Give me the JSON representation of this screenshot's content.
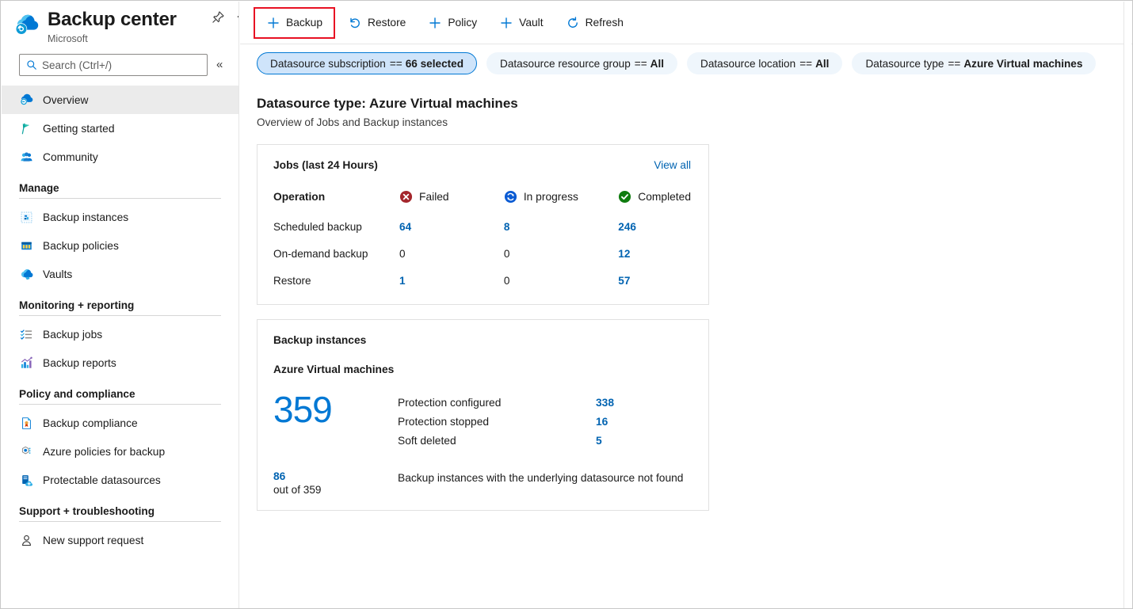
{
  "colors": {
    "accent": "#0078d4",
    "link": "#0063b1",
    "highlight_border": "#e81123",
    "failed": "#a4262c",
    "in_progress": "#0078d4",
    "completed": "#107c10",
    "pill_bg": "#eff6fc",
    "pill_selected_bg": "#cfe4fa"
  },
  "titlebar": {
    "title": "Backup center",
    "subtitle": "Microsoft",
    "logo_icon": "backup-center-cloud-icon",
    "pin_icon": "pin-icon",
    "more_icon": "ellipsis-icon",
    "more_label": "..."
  },
  "search": {
    "placeholder": "Search (Ctrl+/)",
    "value": "",
    "icon": "search-icon",
    "collapse_icon": "chevron-double-left-icon",
    "collapse_label": "«"
  },
  "sidebar": {
    "top_items": [
      {
        "label": "Overview",
        "icon": "backup-cloud-icon",
        "active": true
      },
      {
        "label": "Getting started",
        "icon": "flag-icon",
        "active": false
      },
      {
        "label": "Community",
        "icon": "community-icon",
        "active": false
      }
    ],
    "groups": [
      {
        "title": "Manage",
        "items": [
          {
            "label": "Backup instances",
            "icon": "backup-instances-icon"
          },
          {
            "label": "Backup policies",
            "icon": "backup-policies-icon"
          },
          {
            "label": "Vaults",
            "icon": "vault-cloud-icon"
          }
        ]
      },
      {
        "title": "Monitoring + reporting",
        "items": [
          {
            "label": "Backup jobs",
            "icon": "checklist-icon"
          },
          {
            "label": "Backup reports",
            "icon": "bar-chart-icon"
          }
        ]
      },
      {
        "title": "Policy and compliance",
        "items": [
          {
            "label": "Backup compliance",
            "icon": "compliance-document-icon"
          },
          {
            "label": "Azure policies for backup",
            "icon": "policy-hexagon-icon"
          },
          {
            "label": "Protectable datasources",
            "icon": "protectable-datasource-icon"
          }
        ]
      },
      {
        "title": "Support + troubleshooting",
        "items": [
          {
            "label": "New support request",
            "icon": "support-person-icon"
          }
        ]
      }
    ]
  },
  "toolbar": {
    "commands": [
      {
        "label": "Backup",
        "icon": "plus-icon",
        "highlighted": true
      },
      {
        "label": "Restore",
        "icon": "restore-icon",
        "highlighted": false
      },
      {
        "label": "Policy",
        "icon": "plus-icon",
        "highlighted": false
      },
      {
        "label": "Vault",
        "icon": "plus-icon",
        "highlighted": false
      },
      {
        "label": "Refresh",
        "icon": "refresh-icon",
        "highlighted": false
      }
    ]
  },
  "filters": [
    {
      "name": "Datasource subscription",
      "op": "==",
      "value": "66 selected",
      "selected": true
    },
    {
      "name": "Datasource resource group",
      "op": "==",
      "value": "All",
      "selected": false
    },
    {
      "name": "Datasource location",
      "op": "==",
      "value": "All",
      "selected": false
    },
    {
      "name": "Datasource type",
      "op": "==",
      "value": "Azure Virtual machines",
      "selected": false
    }
  ],
  "page": {
    "title": "Datasource type: Azure Virtual machines",
    "subtitle": "Overview of Jobs and Backup instances"
  },
  "jobs_card": {
    "title": "Jobs (last 24 Hours)",
    "view_all": "View all",
    "columns": [
      {
        "label": "Operation",
        "icon": null,
        "header": true
      },
      {
        "label": "Failed",
        "icon": "error-circle-icon"
      },
      {
        "label": "In progress",
        "icon": "in-progress-circle-icon"
      },
      {
        "label": "Completed",
        "icon": "success-circle-icon"
      }
    ],
    "rows": [
      {
        "operation": "Scheduled backup",
        "failed": "64",
        "in_progress": "8",
        "completed": "246",
        "failed_link": true,
        "in_progress_link": true,
        "completed_link": true
      },
      {
        "operation": "On-demand backup",
        "failed": "0",
        "in_progress": "0",
        "completed": "12",
        "failed_link": false,
        "in_progress_link": false,
        "completed_link": true
      },
      {
        "operation": "Restore",
        "failed": "1",
        "in_progress": "0",
        "completed": "57",
        "failed_link": true,
        "in_progress_link": false,
        "completed_link": true
      }
    ]
  },
  "instances_card": {
    "title": "Backup instances",
    "subtitle": "Azure Virtual machines",
    "total": "359",
    "stats": [
      {
        "label": "Protection configured",
        "value": "338"
      },
      {
        "label": "Protection stopped",
        "value": "16"
      },
      {
        "label": "Soft deleted",
        "value": "5"
      }
    ],
    "footer": {
      "count": "86",
      "out_of": "out of 359",
      "text": "Backup instances with the underlying datasource not found"
    }
  }
}
